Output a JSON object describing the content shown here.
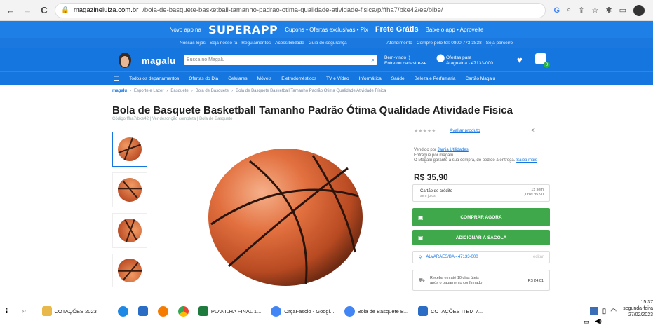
{
  "browser": {
    "url_host": "magazineluiza.com.br",
    "url_path": "/bola-de-basquete-basketball-tamanho-padrao-otima-qualidade-atividade-fisica/p/ffha7/bke42/es/bibe/",
    "back": "←",
    "forward": "→",
    "reload": "C"
  },
  "promo": {
    "left_text": "Novo app na",
    "brand": "SUPERAPP",
    "middle_text": "Cupons • Ofertas exclusivas • Pix",
    "frete": "Frete Grátis",
    "right_text": "Baixe o app • Aproveite"
  },
  "util": {
    "left": [
      "Nossas lojas",
      "Seja nosso fã",
      "Regulamentos",
      "Acessibilidade",
      "Guia de segurança"
    ],
    "right": [
      "Atendimento",
      "Compre pelo tel: 0800 773 3838",
      "Seja parceiro"
    ]
  },
  "header": {
    "logo": "magalu",
    "search_placeholder": "Busca no Magalu",
    "login_line1": "Bem-vindo :)",
    "login_line2": "Entre ou cadastre-se",
    "cep_line1": "Ofertas para",
    "cep_line2": "Araguaína - 47133-000"
  },
  "catnav": {
    "items": [
      "Todos os departamentos",
      "Ofertas do Dia",
      "Celulares",
      "Móveis",
      "Eletrodomésticos",
      "TV e Vídeo",
      "Informática",
      "Saúde",
      "Beleza e Perfumaria",
      "Cartão Magalu"
    ]
  },
  "breadcrumb": {
    "home": "magalu",
    "items": [
      "Esporte e Lazer",
      "Basquete",
      "Bola de Basquete",
      "Bola de Basquete Basketball Tamanho Padrão Ótima Qualidade Atividade Física"
    ]
  },
  "product": {
    "title": "Bola de Basquete Basketball Tamanho Padrão Ótima Qualidade Atividade Física",
    "subline": "Código ffha7/bke42 | Ver descrição completa | Bola de Basquete",
    "rating_link": "Avaliar produto",
    "seller_prefix": "Vendido por",
    "seller_name": "Jamia Utilidades",
    "delivered_by": "Entregue por magalu",
    "guarantee": "O Magalu garante a sua compra, do pedido à entrega.",
    "guarantee_link": "Saiba mais",
    "price": "R$ 35,90",
    "payment_method": "Cartão de crédito",
    "payment_sub": "sem juros",
    "installments_line1": "1x sem",
    "installments_line2": "juros 35,90",
    "buy_button": "COMPRAR AGORA",
    "add_button": "ADICIONAR À SACOLA",
    "cep": "ALVARÃES/BA - 47133-000",
    "cep_edit": "editar",
    "delivery_line1": "Receba em até 10 dias úteis",
    "delivery_line2": "após o pagamento confirmado",
    "delivery_price": "R$ 24,01"
  },
  "taskbar": {
    "items": [
      {
        "label": "COTAÇÕES 2023",
        "color": "#e8b84a"
      },
      {
        "label": "PLANILHA FINAL 1...",
        "color": "#1f7a3e"
      },
      {
        "label": "OrçaFascio - Googl...",
        "color": "#4285f4"
      },
      {
        "label": "Bola de Basquete B...",
        "color": "#4285f4"
      },
      {
        "label": "COTAÇÕES ITEM 7...",
        "color": "#2b6cc4"
      }
    ],
    "time": "15:37",
    "day": "segunda-feira",
    "date": "27/02/2023"
  }
}
